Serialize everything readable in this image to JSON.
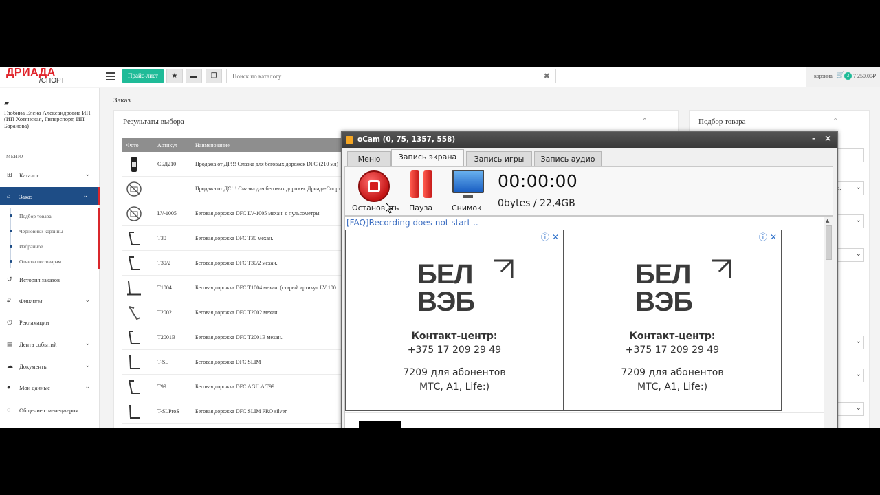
{
  "logo": {
    "line1": "ДРИАДА",
    "line2": "/СПОРТ"
  },
  "toolbar": {
    "price_button": "Прайс-лист",
    "btn_star": "★",
    "btn_folder": "▬",
    "btn_copy": "❐",
    "search_placeholder": "Поиск по каталогу",
    "search_clear": "✖"
  },
  "cart": {
    "label": "корзина",
    "count": "3",
    "sum": "7 250.00₽"
  },
  "user": {
    "name": "Глобина Елена Александровна ИП (ИП Хотянская, Гиперспорт, ИП Баранова)"
  },
  "sidebar": {
    "menu_header": "МЕНЮ",
    "items": [
      {
        "label": "Каталог"
      },
      {
        "label": "Заказ"
      },
      {
        "label": "История заказов"
      },
      {
        "label": "Финансы"
      },
      {
        "label": "Рекламации"
      },
      {
        "label": "Лента событий"
      },
      {
        "label": "Документы"
      },
      {
        "label": "Мои данные"
      },
      {
        "label": "Общение с менеджером"
      }
    ],
    "subitems": [
      {
        "label": "Подбор товара"
      },
      {
        "label": "Черновики корзины"
      },
      {
        "label": "Избранное"
      },
      {
        "label": "Отчеты по товарам"
      }
    ]
  },
  "main": {
    "breadcrumb": "Заказ",
    "panel_title": "Результаты выбора",
    "columns": [
      "Фото",
      "Артикул",
      "Наименование"
    ],
    "rows": [
      {
        "art": "СБД210",
        "name": "Продажа от ДР!!! Смазка для беговых дорожек DFC (210 мл)"
      },
      {
        "art": "",
        "name": "Продажа от ДС!!! Смазка для беговых дорожек Дриада-Спорт"
      },
      {
        "art": "LV-1005",
        "name": "Беговая дорожка DFC LV-1005 механ. с пульсометры"
      },
      {
        "art": "T30",
        "name": "Беговая дорожка DFC T30 механ."
      },
      {
        "art": "T30/2",
        "name": "Беговая дорожка DFC T30/2 механ."
      },
      {
        "art": "T1004",
        "name": "Беговая дорожка DFC T1004 механ. (старый артикул LV 100"
      },
      {
        "art": "T2002",
        "name": "Беговая дорожка DFC T2002 механ."
      },
      {
        "art": "T2001B",
        "name": "Беговая дорожка DFC T2001B механ."
      },
      {
        "art": "T-SL",
        "name": "Беговая дорожка DFC SLIM"
      },
      {
        "art": "T99",
        "name": "Беговая дорожка DFC AGILA T99"
      },
      {
        "art": "T-SLProS",
        "name": "Беговая дорожка DFC SLIM PRO silver"
      }
    ],
    "side_title": "Подбор товара",
    "side_field_text": "а,"
  },
  "ocam": {
    "title": "oCam (0, 75, 1357, 558)",
    "minimize": "–",
    "close": "✕",
    "tabs": [
      "Меню",
      "Запись экрана",
      "Запись игры",
      "Запись аудио"
    ],
    "tools": {
      "stop": "Остановить",
      "pause": "Пауза",
      "snapshot": "Снимок"
    },
    "timer": "00:00:00",
    "bytes": "0bytes / 22,4GB",
    "faq": "[FAQ]Recording does not start ..",
    "ad": {
      "brand_line1": "БЕЛ",
      "brand_line2": "ВЭБ",
      "contact_title": "Контакт-центр:",
      "phone": "+375 17 209 29 49",
      "short_number": "7209 для абонентов",
      "operators": "МТС, А1, Life:)"
    }
  },
  "colors": {
    "accent_green": "#1fbb98",
    "nav_active": "#1e4d86",
    "brand_red": "#e0242b"
  }
}
